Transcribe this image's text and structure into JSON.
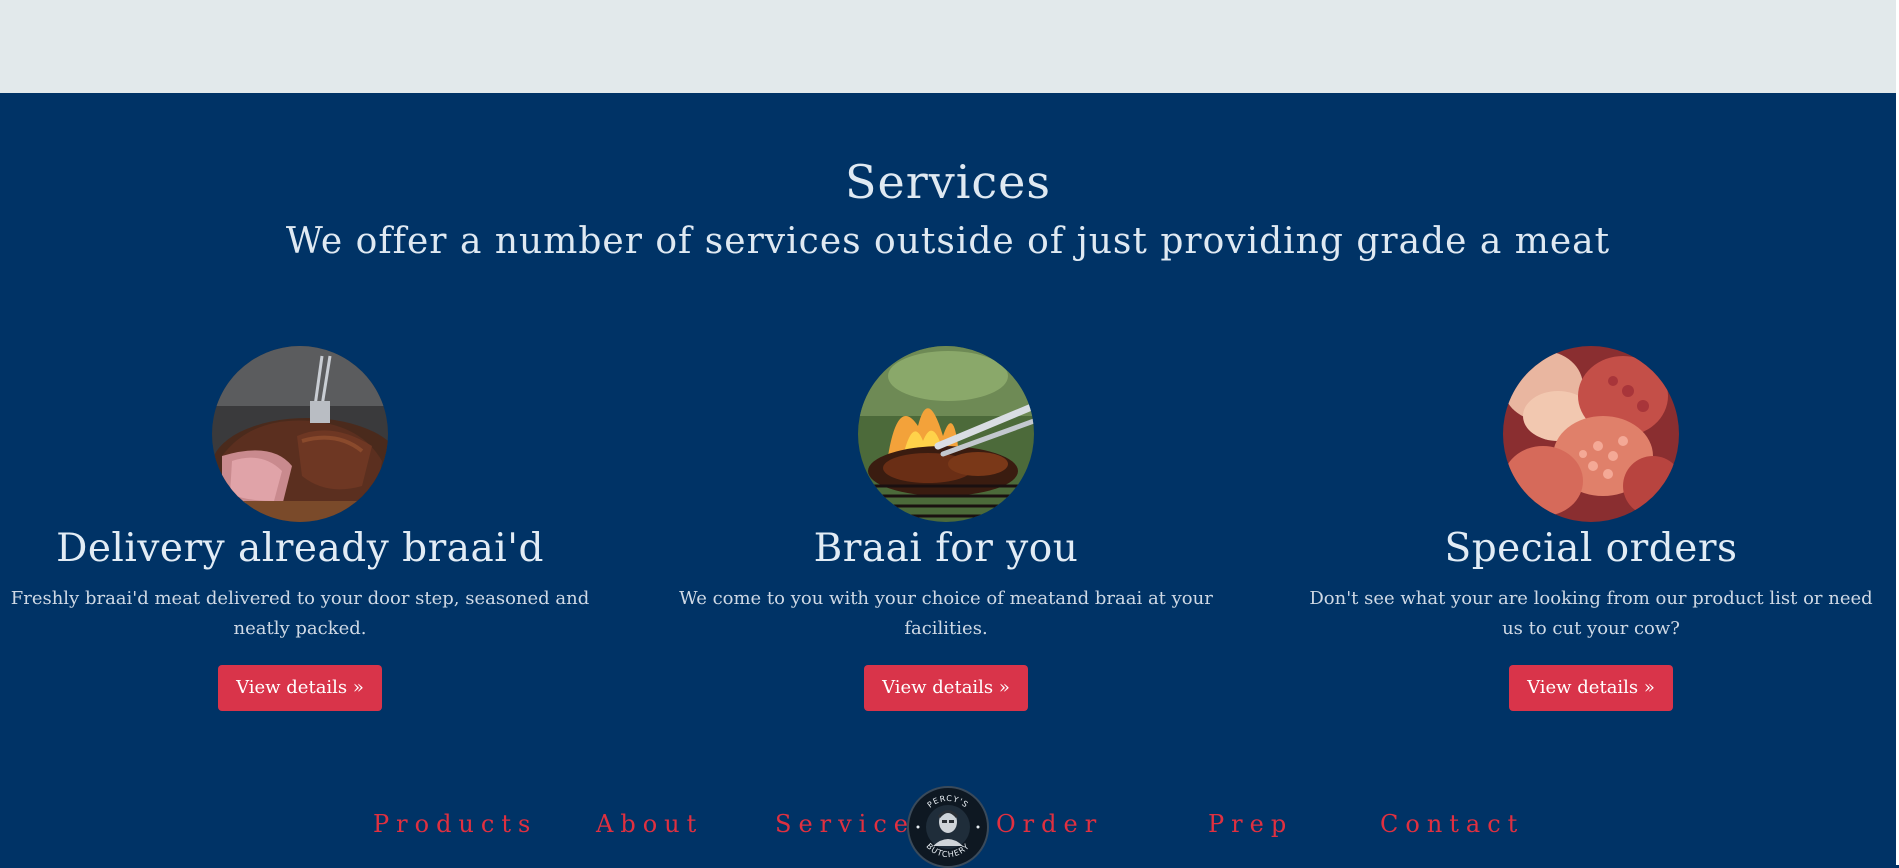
{
  "services": {
    "title": "Services",
    "subtitle": "We offer a number of services outside of just providing grade a meat",
    "items": [
      {
        "image_icon": "steak-photo",
        "heading": "Delivery already braai'd",
        "description": "Freshly braai'd meat delivered to your door step, seasoned and neatly packed.",
        "button_label": "View details »"
      },
      {
        "image_icon": "grill-photo",
        "heading": "Braai for you",
        "description": "We come to you with your choice of meatand braai at your facilities.",
        "button_label": "View details »"
      },
      {
        "image_icon": "offal-photo",
        "heading": "Special orders",
        "description": "Don't see what your are looking from our product list or need us to cut your cow?",
        "button_label": "View details »"
      }
    ]
  },
  "nav": {
    "items": [
      "Products",
      "About",
      "Services",
      "Order",
      "Prep",
      "Contact"
    ],
    "logo_text": "PERCY'S BUTCHERY"
  },
  "colors": {
    "background": "#003366",
    "top_band": "#e2e9eb",
    "button": "#d9344a",
    "nav_text": "#e03040",
    "heading_text": "#dfe9f2"
  }
}
